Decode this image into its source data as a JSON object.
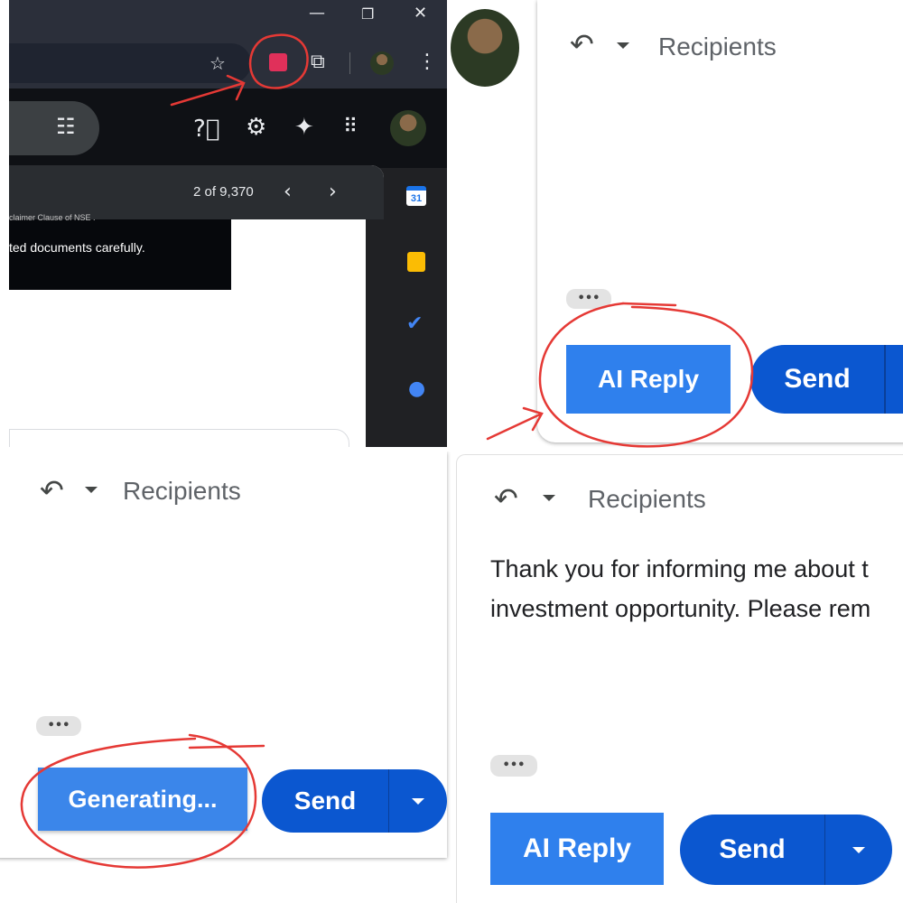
{
  "panel1": {
    "pagination": "2 of 9,370",
    "snippet_top": "claimer Clause of NSE .",
    "snippet_main": "ted documents carefully.",
    "icons": [
      "minimize-icon",
      "maximize-icon",
      "close-icon",
      "star-icon",
      "extension-icon",
      "puzzle-icon",
      "more-vert-icon",
      "filter-icon",
      "help-icon",
      "settings-icon",
      "sparkle-icon",
      "apps-grid-icon",
      "calendar-icon",
      "keep-icon",
      "tasks-icon",
      "contacts-icon"
    ],
    "calendar_day": "31"
  },
  "panel2": {
    "recipients": "Recipients",
    "more_dots": "•••",
    "ai_reply": "AI Reply",
    "send": "Send"
  },
  "panel3": {
    "recipients": "Recipients",
    "more_dots": "•••",
    "generating": "Generating...",
    "send": "Send"
  },
  "panel4": {
    "recipients": "Recipients",
    "body_line1": "Thank you for informing me about t",
    "body_line2": "investment opportunity. Please rem",
    "more_dots": "•••",
    "ai_reply": "AI Reply",
    "send": "Send"
  },
  "colors": {
    "ai_button": "#2f80ed",
    "send_button": "#0b57d0",
    "annotation": "#e53935"
  }
}
